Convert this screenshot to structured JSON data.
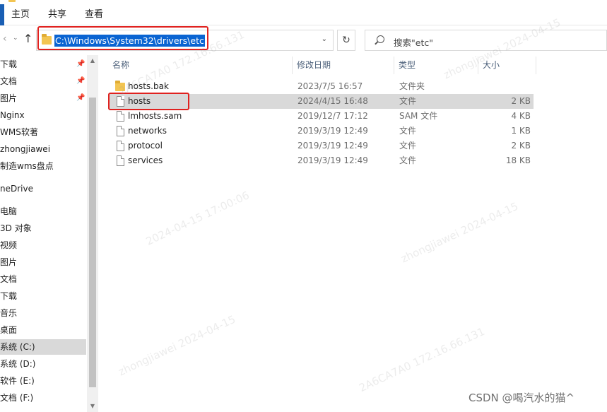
{
  "ribbon": {
    "tabs": [
      "主页",
      "共享",
      "查看"
    ]
  },
  "address": {
    "path": "C:\\Windows\\System32\\drivers\\etc",
    "search_placeholder": "搜索\"etc\""
  },
  "nav": {
    "items": [
      {
        "label": "下载",
        "pinned": true
      },
      {
        "label": "文档",
        "pinned": true
      },
      {
        "label": "图片",
        "pinned": true
      },
      {
        "label": "Nginx",
        "pinned": false
      },
      {
        "label": "WMS软著",
        "pinned": false
      },
      {
        "label": "zhongjiawei",
        "pinned": false
      },
      {
        "label": "制造wms盘点",
        "pinned": false
      },
      {
        "label": "neDrive",
        "pinned": false
      },
      {
        "label": "电脑",
        "pinned": false
      },
      {
        "label": "3D 对象",
        "pinned": false
      },
      {
        "label": "视频",
        "pinned": false
      },
      {
        "label": "图片",
        "pinned": false
      },
      {
        "label": "文档",
        "pinned": false
      },
      {
        "label": "下载",
        "pinned": false
      },
      {
        "label": "音乐",
        "pinned": false
      },
      {
        "label": "桌面",
        "pinned": false
      },
      {
        "label": "系统 (C:)",
        "pinned": false,
        "selected": true
      },
      {
        "label": "系统 (D:)",
        "pinned": false
      },
      {
        "label": "软件 (E:)",
        "pinned": false
      },
      {
        "label": "文档 (F:)",
        "pinned": false
      }
    ]
  },
  "columns": {
    "name": "名称",
    "modified": "修改日期",
    "type": "类型",
    "size": "大小"
  },
  "files": [
    {
      "name": "hosts.bak",
      "modified": "2023/7/5 16:57",
      "type": "文件夹",
      "size": "",
      "icon": "folder-icon"
    },
    {
      "name": "hosts",
      "modified": "2024/4/15 16:48",
      "type": "文件",
      "size": "2 KB",
      "icon": "file-icon",
      "selected": true
    },
    {
      "name": "lmhosts.sam",
      "modified": "2019/12/7 17:12",
      "type": "SAM 文件",
      "size": "4 KB",
      "icon": "file-icon"
    },
    {
      "name": "networks",
      "modified": "2019/3/19 12:49",
      "type": "文件",
      "size": "1 KB",
      "icon": "file-icon"
    },
    {
      "name": "protocol",
      "modified": "2019/3/19 12:49",
      "type": "文件",
      "size": "2 KB",
      "icon": "file-icon"
    },
    {
      "name": "services",
      "modified": "2019/3/19 12:49",
      "type": "文件",
      "size": "18 KB",
      "icon": "file-icon"
    }
  ],
  "footer": {
    "credit": "CSDN @喝汽水的猫^"
  },
  "colors": {
    "address_highlight": "#0a64d2",
    "annotation_red": "#e0221f",
    "selection_gray": "#d9d9d9",
    "folder_yellow": "#f3c552"
  }
}
